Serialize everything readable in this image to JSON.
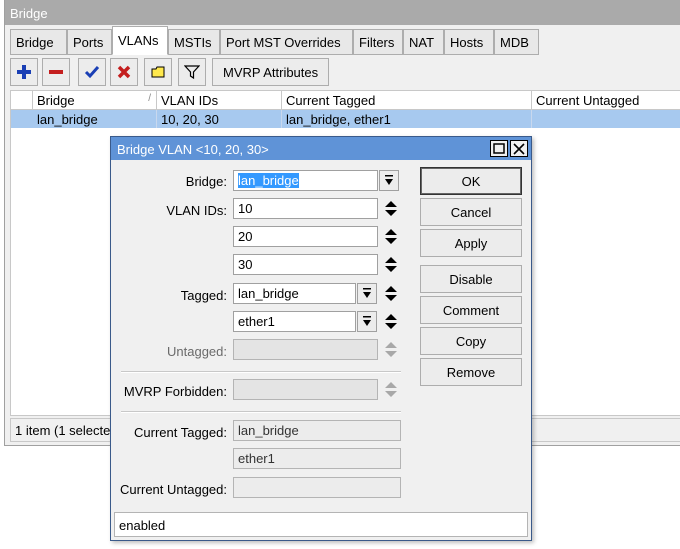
{
  "window": {
    "title": "Bridge"
  },
  "tabs": [
    "Bridge",
    "Ports",
    "VLANs",
    "MSTIs",
    "Port MST Overrides",
    "Filters",
    "NAT",
    "Hosts",
    "MDB"
  ],
  "toolbar": {
    "icons": [
      "add-icon",
      "remove-icon",
      "enable-icon",
      "disable-icon",
      "comment-icon",
      "filter-icon"
    ],
    "mvrp_label": "MVRP Attributes"
  },
  "grid": {
    "sort_indicator": "/",
    "columns": [
      "Bridge",
      "VLAN IDs",
      "Current Tagged",
      "Current Untagged"
    ],
    "rows": [
      [
        "lan_bridge",
        "10, 20, 30",
        "lan_bridge, ether1",
        ""
      ]
    ]
  },
  "status": {
    "text": "1 item (1 selected)"
  },
  "colors": {
    "selection": "#a7c9ef",
    "dialog_title": "#5f93d7",
    "field_selected": "#3399ff"
  },
  "dialog": {
    "title": "Bridge VLAN <10, 20, 30>",
    "labels": {
      "bridge": "Bridge:",
      "vlan_ids": "VLAN IDs:",
      "tagged": "Tagged:",
      "untagged": "Untagged:",
      "mvrp_forbidden": "MVRP Forbidden:",
      "current_tagged": "Current Tagged:",
      "current_untagged": "Current Untagged:"
    },
    "bridge": "lan_bridge",
    "vlan_ids": [
      "10",
      "20",
      "30"
    ],
    "tagged": [
      "lan_bridge",
      "ether1"
    ],
    "untagged": "",
    "mvrp_forbidden": "",
    "current_tagged": [
      "lan_bridge",
      "ether1"
    ],
    "current_untagged": "",
    "buttons": [
      "OK",
      "Cancel",
      "Apply",
      "Disable",
      "Comment",
      "Copy",
      "Remove"
    ],
    "status": "enabled"
  }
}
